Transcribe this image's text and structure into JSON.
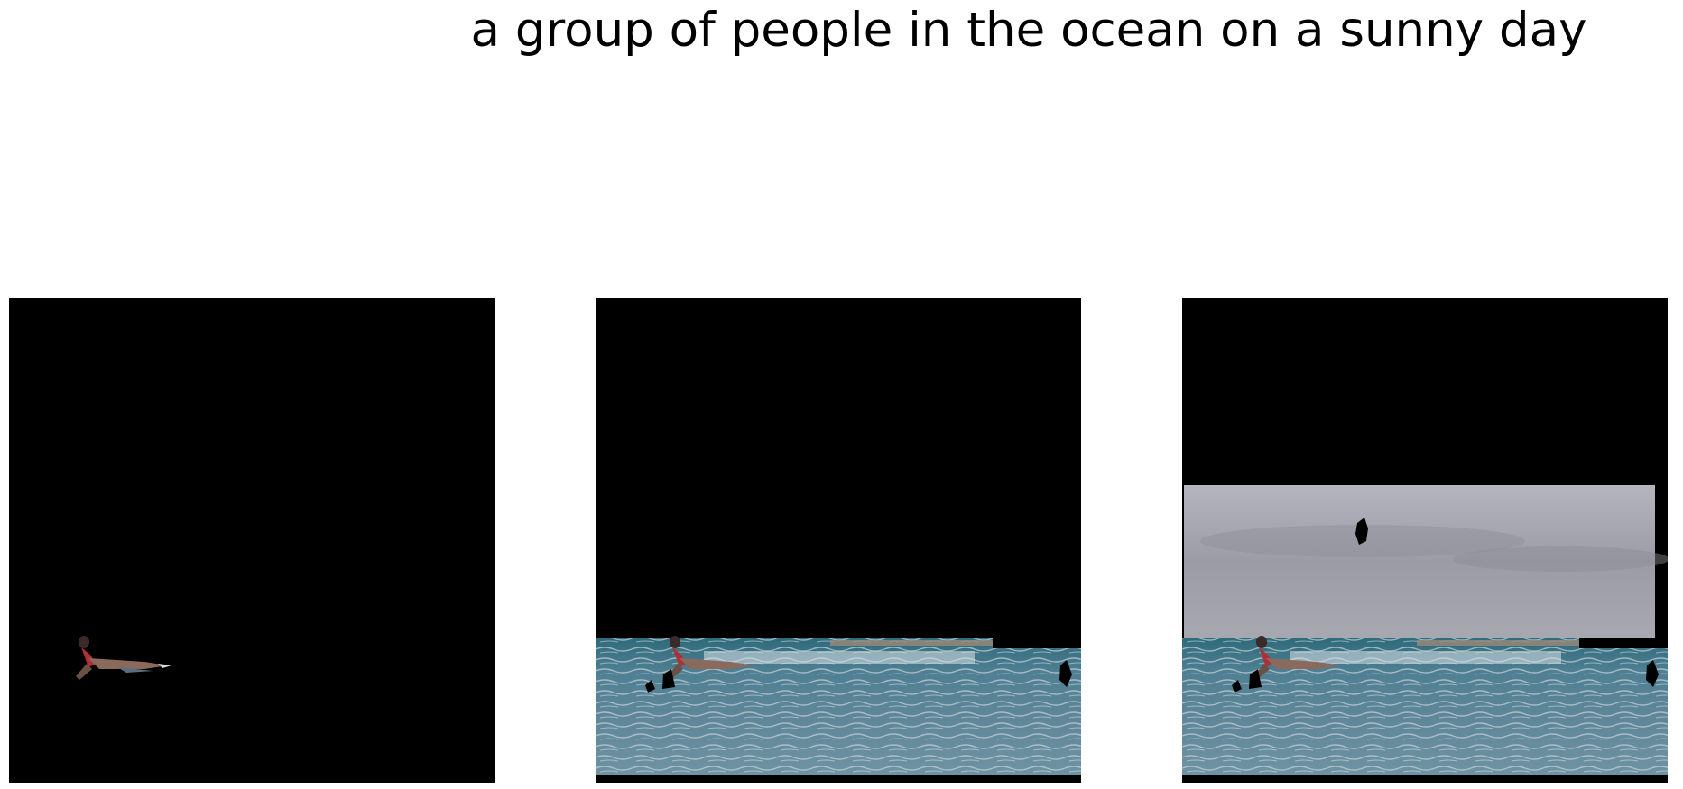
{
  "caption": "a group of people in the ocean on a sunny day",
  "panels": [
    {
      "id": "panel-1",
      "content": "person-only"
    },
    {
      "id": "panel-2",
      "content": "person-and-sea"
    },
    {
      "id": "panel-3",
      "content": "person-sea-and-sky"
    }
  ],
  "colors": {
    "mask": "#000000",
    "sea_dark": "#2f5d6f",
    "sea_mid": "#4f7f93",
    "sea_light": "#7aa3b4",
    "foam": "#c9d3db",
    "sky": "#a8a9b2",
    "cloud": "#8f909a",
    "skin": "#8a6a5c",
    "suit": "#b0303a"
  }
}
